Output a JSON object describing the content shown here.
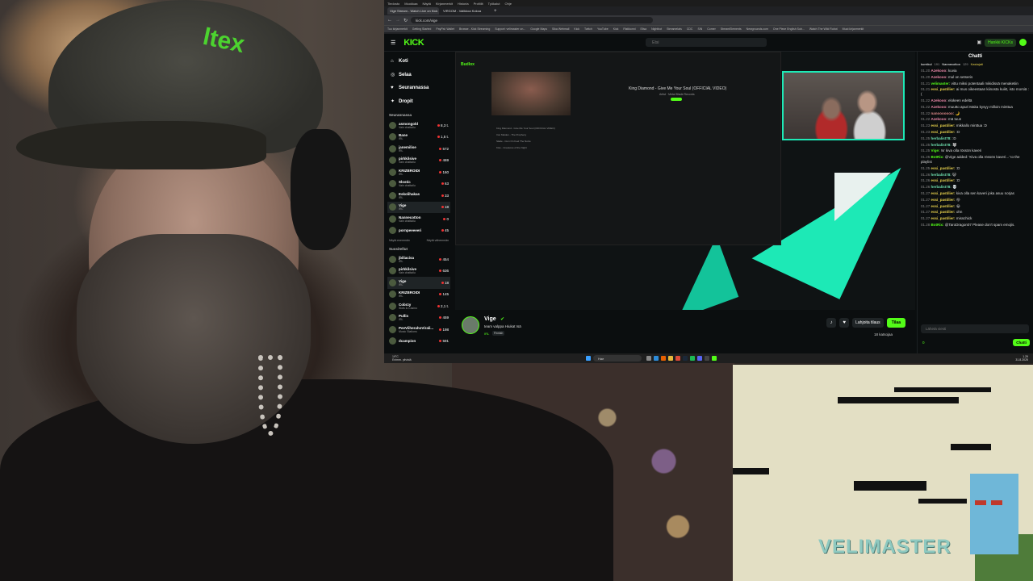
{
  "browser": {
    "menu": [
      "Tiedosto",
      "Muokkaa",
      "Näytä",
      "Kirjanmerkit",
      "Historia",
      "Profiilit",
      "Työkalut",
      "Ohje"
    ],
    "tabs": [
      {
        "label": "Vige Stream - Watch Live on Kick"
      },
      {
        "label": "VIRGOM - Valikkoa Kokoa"
      }
    ],
    "url": "kick.com/vige",
    "bookmarks": [
      "Tuo kirjanmerkit",
      "Getting Started",
      "PayPal: Wallet",
      "Browse - Kick Streaming",
      "Support: velimaster on...",
      "Google Maps",
      "Sika Webmail",
      "Kick",
      "Twitch",
      "YouTube",
      "Kick",
      "Ristikonni",
      "Elisa",
      "Nightbot",
      "Streamelats",
      "CDC",
      "SIN",
      "Comer",
      "StreamElements",
      "Newgrounds.com",
      "One Piece English Sub...",
      "Watch The Wild Robot",
      "Muut kirjanmerkit"
    ]
  },
  "kick": {
    "logo": "KICK",
    "search_placeholder": "Etsi",
    "user_label": "Hankki KICKs",
    "nav": [
      {
        "label": "Koti",
        "icon": "home-icon"
      },
      {
        "label": "Selaa",
        "icon": "compass-icon"
      },
      {
        "label": "Seurannassa",
        "icon": "heart-icon"
      },
      {
        "label": "Dropit",
        "icon": "gift-icon"
      }
    ],
    "following_header": "Seurannassa",
    "following": [
      {
        "name": "asmongold",
        "cat": "Vain chattailu",
        "viewers": "8,3 t."
      },
      {
        "name": "Bane",
        "cat": "IRL",
        "viewers": "1,5 t."
      },
      {
        "name": "janemilise",
        "cat": "IRL",
        "viewers": "572"
      },
      {
        "name": "pirkkilsive",
        "cat": "Vain chattailu",
        "viewers": "469"
      },
      {
        "name": "KRIZBROIDI",
        "cat": "IRL",
        "viewers": "160"
      },
      {
        "name": "Slostic",
        "cat": "Vain chattailu",
        "viewers": "63"
      },
      {
        "name": "Eskolihakas",
        "cat": "IRL",
        "viewers": "33"
      },
      {
        "name": "Vige",
        "cat": "IRL",
        "viewers": "18",
        "selected": true
      },
      {
        "name": "Nannecotton",
        "cat": "Vain chattailu",
        "viewers": "0"
      },
      {
        "name": "pornpeeeeeri",
        "cat": "",
        "viewers": "45"
      }
    ],
    "show_more": "Näytä enemmän",
    "show_less": "Näytä vähemmän",
    "recommended_header": "Suositellut",
    "recommended": [
      {
        "name": "jbiliacisa",
        "cat": "IRL",
        "viewers": "454"
      },
      {
        "name": "pirkkilsive",
        "cat": "Vain chattailu",
        "viewers": "636"
      },
      {
        "name": "Vige",
        "cat": "IRL",
        "viewers": "18",
        "selected": true
      },
      {
        "name": "KRIZBROIDI",
        "cat": "IRL",
        "viewers": "145"
      },
      {
        "name": "Cobrzy",
        "cat": "Slots & Casino",
        "viewers": "2,1 t."
      },
      {
        "name": "Pullis",
        "cat": "IRL",
        "viewers": "459"
      },
      {
        "name": "PeeViiherahoVirali...",
        "cat": "Music Stations",
        "viewers": "198"
      },
      {
        "name": "dcampion",
        "cat": "",
        "viewers": "591"
      }
    ],
    "player": {
      "inner_logo": "Budlox",
      "song_title": "King Diamond - Give Me Your Soul (OFFICIAL VIDEO)",
      "song_sub": "Artist · Metal Blade Records",
      "rows": [
        "King Diamond - Give Me Your Soul (OFFICIAL VIDEO)",
        "Iron Maiden - The Prophecy",
        "Slade - Cum On Feel The Noize",
        "Kiss - Creatures of the Night"
      ]
    },
    "stream": {
      "name": "Vige",
      "title": "team valppa Hiukat Isä",
      "category": "IRL",
      "tag": "Finnish",
      "viewers": "18 katsojaa",
      "gift_label": "Lahjoita tilaus",
      "sub_label": "Tilaa"
    },
    "chat": {
      "title": "Chatti",
      "pinned": [
        {
          "user": "kumikul",
          "count": "191"
        },
        {
          "user": "Nannecotton",
          "count": "129"
        },
        {
          "user": "Kastajati",
          "count": ""
        }
      ],
      "messages": [
        {
          "t": "01.20",
          "u": "Azekooo:",
          "c": "#e8a",
          "m": "kuvia"
        },
        {
          "t": "01.20",
          "u": "Azekooo:",
          "c": "#e8a",
          "m": "mul on setseris"
        },
        {
          "t": "01.21",
          "u": "velimaster:",
          "c": "#53fc18",
          "m": "vittu miksi potentaali mikidissä menaketiin"
        },
        {
          "t": "01.21",
          "u": "essi_pastilier:",
          "c": "#e6d04c",
          "m": "ai mus oikeestaan kiinosta kuikt, isto morsiä :("
        },
        {
          "t": "01.22",
          "u": "Azekooo:",
          "c": "#e8a",
          "m": "elokeen edeltä"
        },
        {
          "t": "01.22",
          "u": "Azekooo:",
          "c": "#e8a",
          "m": "muutto apuri Maka kysyy milloin minttua"
        },
        {
          "t": "01.22",
          "u": "nanooooooo:",
          "c": "#d88",
          "m": "🌙"
        },
        {
          "t": "01.22",
          "u": "Azekooo:",
          "c": "#e8a",
          "m": "mä tuun"
        },
        {
          "t": "01.23",
          "u": "essi_pastilier:",
          "c": "#e6d04c",
          "m": "mikkallo minttua :D"
        },
        {
          "t": "01.23",
          "u": "essi_pastilier:",
          "c": "#e6d04c",
          "m": ":D"
        },
        {
          "t": "01.25",
          "u": "herbalist78:",
          "c": "#6fe0b0",
          "m": ":D"
        },
        {
          "t": "01.25",
          "u": "herbalist78:",
          "c": "#6fe0b0",
          "m": "🐺"
        },
        {
          "t": "01.25",
          "u": "Vige:",
          "c": "#53fc18",
          "m": "!sr kiva olla rössön kaveri"
        },
        {
          "t": "01.25",
          "u": "BotRix:",
          "c": "#53fc18",
          "m": "@Vige added: 'Kiva olla rössön kaveri...' to the playlist"
        },
        {
          "t": "01.25",
          "u": "essi_pastilier:",
          "c": "#e6d04c",
          "m": ":D"
        },
        {
          "t": "01.26",
          "u": "herbalist78:",
          "c": "#6fe0b0",
          "m": "😺"
        },
        {
          "t": "01.26",
          "u": "essi_pastilier:",
          "c": "#e6d04c",
          "m": ":D"
        },
        {
          "t": "01.26",
          "u": "herbalist78:",
          "c": "#6fe0b0",
          "m": "💀"
        },
        {
          "t": "01.27",
          "u": "essi_pastilier:",
          "c": "#e6d04c",
          "m": "kiva olla sen kaveri joka asuu norjas"
        },
        {
          "t": "01.27",
          "u": "essi_pastilier:",
          "c": "#e6d04c",
          "m": "😝"
        },
        {
          "t": "01.27",
          "u": "essi_pastilier:",
          "c": "#e6d04c",
          "m": "😀"
        },
        {
          "t": "01.27",
          "u": "essi_pastilier:",
          "c": "#e6d04c",
          "m": "ohn"
        },
        {
          "t": "01.27",
          "u": "essi_pastilier:",
          "c": "#e6d04c",
          "m": "misschick"
        },
        {
          "t": "01.28",
          "u": "BotRix:",
          "c": "#53fc18",
          "m": "@TaroDragon07 Please don't spam emojis."
        }
      ],
      "input_placeholder": "Lähetä viesti",
      "points": "0",
      "send_label": "Chatti"
    }
  },
  "taskbar": {
    "weather_temp": "19°C",
    "weather_desc": "Enimm. pilvistä",
    "search_placeholder": "Hae",
    "time": "1.29",
    "date": "31.8.2025"
  },
  "game": {
    "logo": "VELIMASTER"
  }
}
